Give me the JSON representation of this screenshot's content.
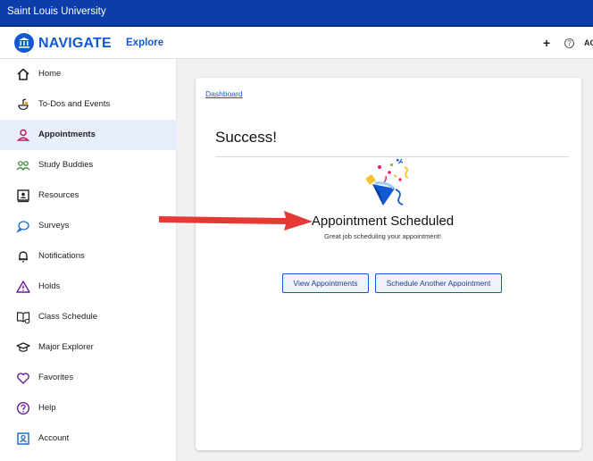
{
  "topbar": {
    "title": "Saint Louis University"
  },
  "appbar": {
    "brand": "NAVIGATE",
    "explore": "Explore",
    "plus": "+",
    "help": "?",
    "account_abbrev": "AC"
  },
  "sidebar": {
    "items": [
      {
        "label": "Home",
        "icon": "home-icon"
      },
      {
        "label": "To-Dos and Events",
        "icon": "todo-icon"
      },
      {
        "label": "Appointments",
        "icon": "person-icon",
        "active": true
      },
      {
        "label": "Study Buddies",
        "icon": "people-icon"
      },
      {
        "label": "Resources",
        "icon": "resources-icon"
      },
      {
        "label": "Surveys",
        "icon": "chat-icon"
      },
      {
        "label": "Notifications",
        "icon": "bell-icon"
      },
      {
        "label": "Holds",
        "icon": "warning-icon"
      },
      {
        "label": "Class Schedule",
        "icon": "schedule-icon"
      },
      {
        "label": "Major Explorer",
        "icon": "grad-cap-icon"
      },
      {
        "label": "Favorites",
        "icon": "heart-icon"
      },
      {
        "label": "Help",
        "icon": "help-icon"
      },
      {
        "label": "Account",
        "icon": "account-icon"
      }
    ]
  },
  "main": {
    "breadcrumb": "Dashboard",
    "title": "Success!",
    "headline": "Appointment Scheduled",
    "subline": "Great job scheduling your appointment!",
    "buttons": {
      "view": "View Appointments",
      "schedule": "Schedule Another Appointment"
    }
  },
  "colors": {
    "brand": "#1059d1",
    "topbar": "#0b3ea8",
    "arrow": "#e53935",
    "active_bg": "#e8eefb"
  }
}
